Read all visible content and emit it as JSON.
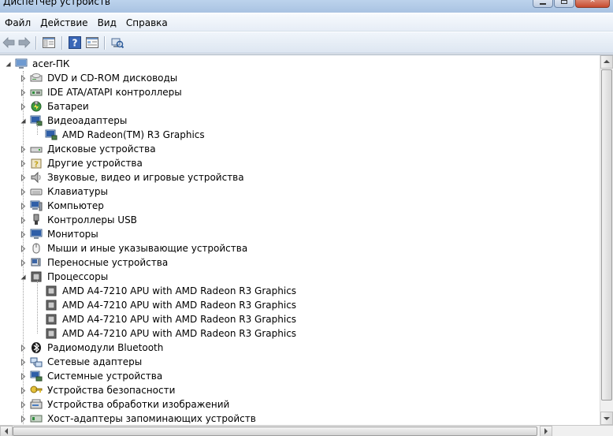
{
  "window": {
    "title": "Диспетчер устройств",
    "accent_color": "#a9c3e2",
    "close_color": "#c74b2f"
  },
  "menu": [
    "Файл",
    "Действие",
    "Вид",
    "Справка"
  ],
  "toolbar": {
    "buttons": [
      "back-arrow-icon",
      "forward-arrow-icon",
      "console-tree-icon",
      "help-icon",
      "properties-icon",
      "scan-hardware-icon"
    ]
  },
  "tree": {
    "root": "acer-ПК",
    "nodes": [
      {
        "label": "DVD и CD-ROM дисководы",
        "icon": "dvd-drive-icon",
        "expanded": false
      },
      {
        "label": "IDE ATA/ATAPI контроллеры",
        "icon": "ide-controller-icon",
        "expanded": false
      },
      {
        "label": "Батареи",
        "icon": "battery-icon",
        "expanded": false
      },
      {
        "label": "Видеоадаптеры",
        "icon": "display-adapter-icon",
        "expanded": true,
        "children": [
          "AMD Radeon(TM) R3 Graphics"
        ]
      },
      {
        "label": "Дисковые устройства",
        "icon": "disk-drive-icon",
        "expanded": false
      },
      {
        "label": "Другие устройства",
        "icon": "other-devices-icon",
        "expanded": false
      },
      {
        "label": "Звуковые, видео и игровые устройства",
        "icon": "speaker-icon",
        "expanded": false
      },
      {
        "label": "Клавиатуры",
        "icon": "keyboard-icon",
        "expanded": false
      },
      {
        "label": "Компьютер",
        "icon": "computer-icon",
        "expanded": false
      },
      {
        "label": "Контроллеры USB",
        "icon": "usb-icon",
        "expanded": false
      },
      {
        "label": "Мониторы",
        "icon": "monitor-icon",
        "expanded": false
      },
      {
        "label": "Мыши и иные указывающие устройства",
        "icon": "mouse-icon",
        "expanded": false
      },
      {
        "label": "Переносные устройства",
        "icon": "portable-device-icon",
        "expanded": false
      },
      {
        "label": "Процессоры",
        "icon": "processor-icon",
        "expanded": true,
        "children": [
          "AMD A4-7210 APU with AMD Radeon R3 Graphics",
          "AMD A4-7210 APU with AMD Radeon R3 Graphics",
          "AMD A4-7210 APU with AMD Radeon R3 Graphics",
          "AMD A4-7210 APU with AMD Radeon R3 Graphics"
        ]
      },
      {
        "label": "Радиомодули Bluetooth",
        "icon": "bluetooth-icon",
        "expanded": false
      },
      {
        "label": "Сетевые адаптеры",
        "icon": "network-adapter-icon",
        "expanded": false
      },
      {
        "label": "Системные устройства",
        "icon": "system-device-icon",
        "expanded": false
      },
      {
        "label": "Устройства безопасности",
        "icon": "security-key-icon",
        "expanded": false
      },
      {
        "label": "Устройства обработки изображений",
        "icon": "imaging-device-icon",
        "expanded": false
      },
      {
        "label": "Хост-адаптеры запоминающих устройств",
        "icon": "storage-controller-icon",
        "expanded": false
      }
    ]
  }
}
